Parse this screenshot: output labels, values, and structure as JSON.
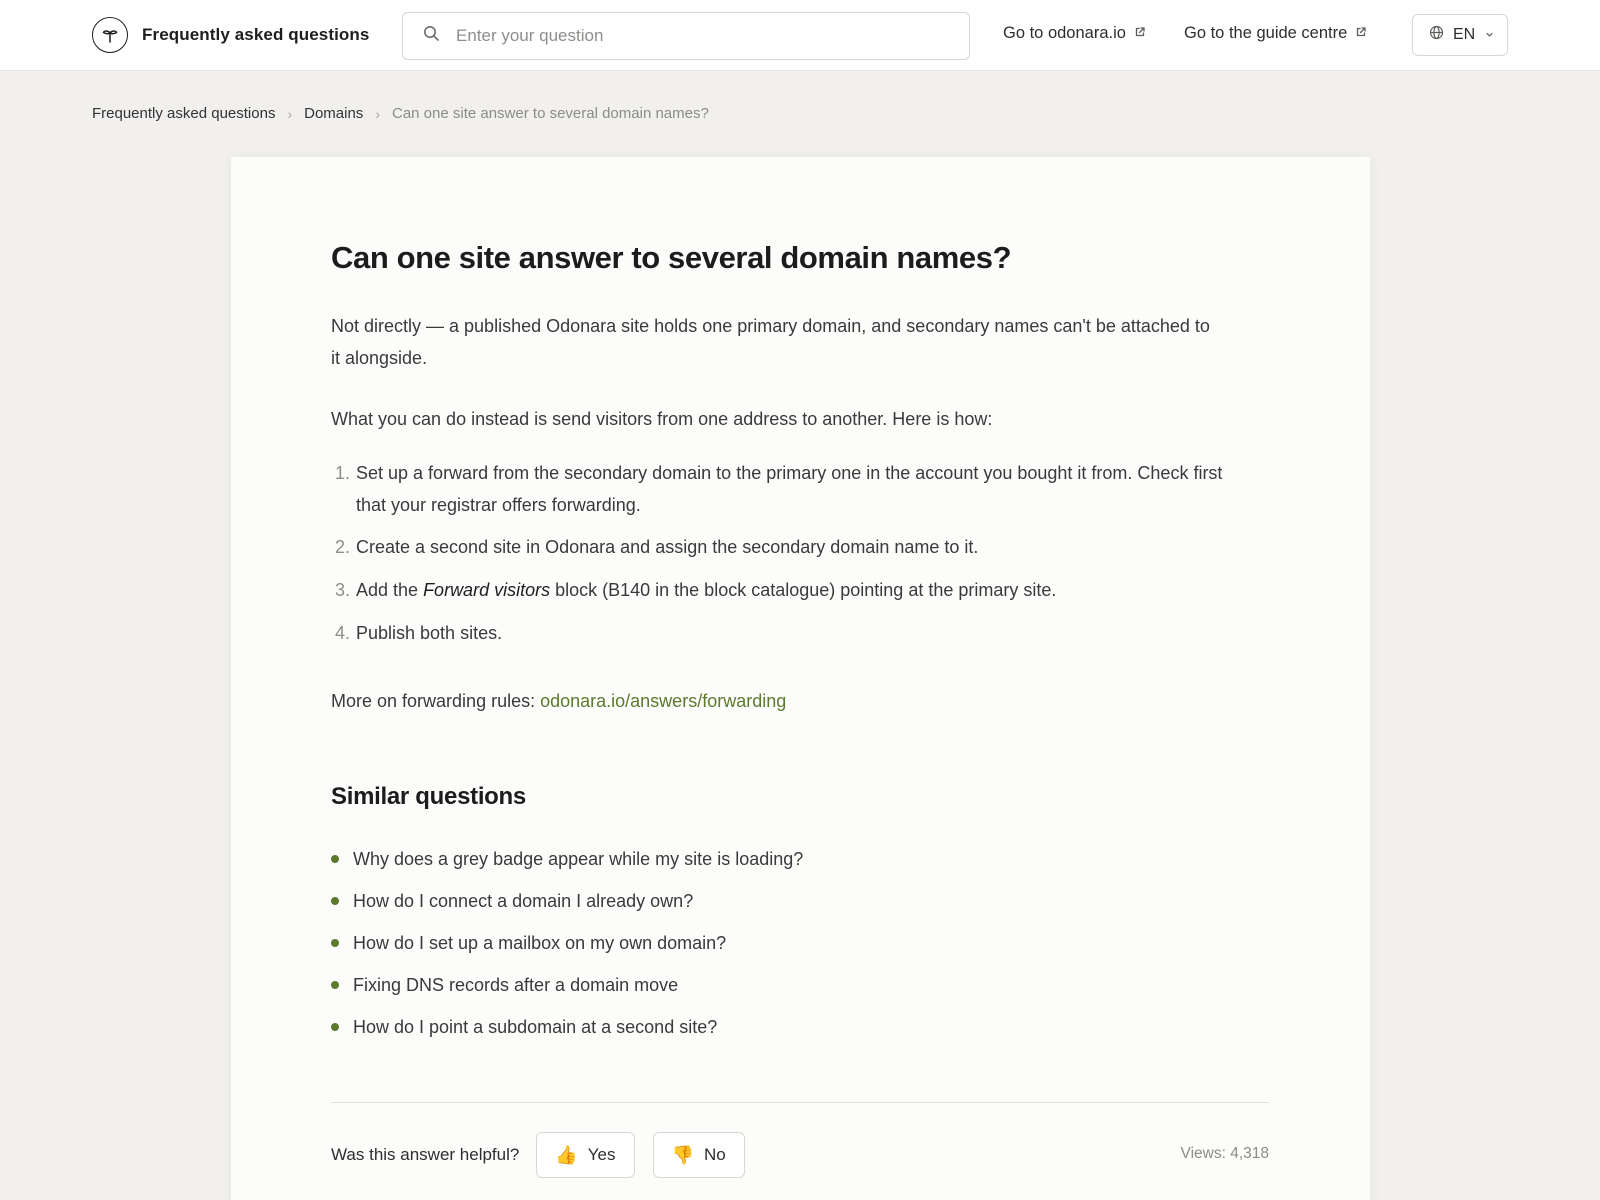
{
  "header": {
    "brand_title": "Frequently asked questions",
    "search_placeholder": "Enter your question",
    "links": [
      {
        "label": "Go to odonara.io"
      },
      {
        "label": "Go to the guide centre"
      }
    ],
    "language": "EN"
  },
  "breadcrumb": {
    "items": [
      "Frequently asked questions",
      "Domains"
    ],
    "current": "Can one site answer to several domain names?"
  },
  "article": {
    "title": "Can one site answer to several domain names?",
    "paragraphs": [
      "Not directly — a published Odonara site holds one primary domain, and secondary names can't be attached to it alongside.",
      "What you can do instead is send visitors from one address to another. Here is how:"
    ],
    "steps": [
      {
        "num": "1.",
        "text": "Set up a forward from the secondary domain to the primary one in the account you bought it from. Check first that your registrar offers forwarding."
      },
      {
        "num": "2.",
        "text": "Create a second site in Odonara and assign the secondary domain name to it."
      },
      {
        "num": "3.",
        "pre": "Add the ",
        "em": "Forward visitors",
        "post": " block (B140 in the block catalogue) pointing at the primary site."
      },
      {
        "num": "4.",
        "text": "Publish both sites."
      }
    ],
    "more_label": "More on forwarding rules: ",
    "more_link": "odonara.io/answers/forwarding"
  },
  "similar": {
    "heading": "Similar questions",
    "items": [
      "Why does a grey badge appear while my site is loading?",
      "How do I connect a domain I already own?",
      "How do I set up a mailbox on my own domain?",
      "Fixing DNS records after a domain move",
      "How do I point a subdomain at a second site?"
    ]
  },
  "feedback": {
    "question": "Was this answer helpful?",
    "yes_emoji": "👍",
    "yes_label": "Yes",
    "no_emoji": "👎",
    "no_label": "No",
    "views": "Views: 4,318"
  },
  "colors": {
    "accent": "#5b7a2e",
    "page_bg": "#f1f0ee",
    "card_bg": "#fcfcfb"
  }
}
